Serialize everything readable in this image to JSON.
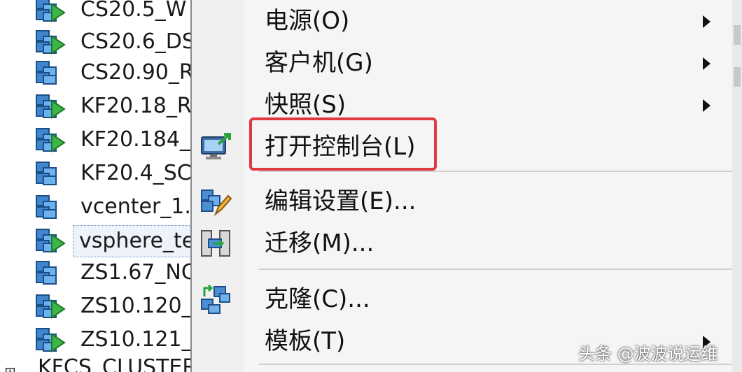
{
  "tree": {
    "items": [
      {
        "label": "CS20.5_W",
        "state": "running"
      },
      {
        "label": "CS20.6_DS",
        "state": "running"
      },
      {
        "label": "CS20.90_R",
        "state": "stopped"
      },
      {
        "label": "KF20.18_R",
        "state": "running"
      },
      {
        "label": "KF20.184_",
        "state": "running"
      },
      {
        "label": "KF20.4_SC",
        "state": "stopped"
      },
      {
        "label": "vcenter_1.",
        "state": "stopped"
      },
      {
        "label": "vsphere_te",
        "state": "running",
        "selected": true
      },
      {
        "label": "ZS1.67_NC",
        "state": "stopped"
      },
      {
        "label": "ZS10.120_",
        "state": "running"
      },
      {
        "label": "ZS10.121_",
        "state": "running"
      }
    ],
    "cluster": {
      "label": "KFCS_CLUSTER"
    }
  },
  "menu": {
    "power": {
      "label": "电源(O)"
    },
    "guest": {
      "label": "客户机(G)"
    },
    "snapshot": {
      "label": "快照(S)"
    },
    "open_console": {
      "label": "打开控制台(L)"
    },
    "edit_settings": {
      "label": "编辑设置(E)..."
    },
    "migrate": {
      "label": "迁移(M)..."
    },
    "clone": {
      "label": "克隆(C)..."
    },
    "template": {
      "label": "模板(T)"
    }
  },
  "highlight_color": "#e0393e",
  "watermark": {
    "text": "头条 @波波说运维"
  }
}
